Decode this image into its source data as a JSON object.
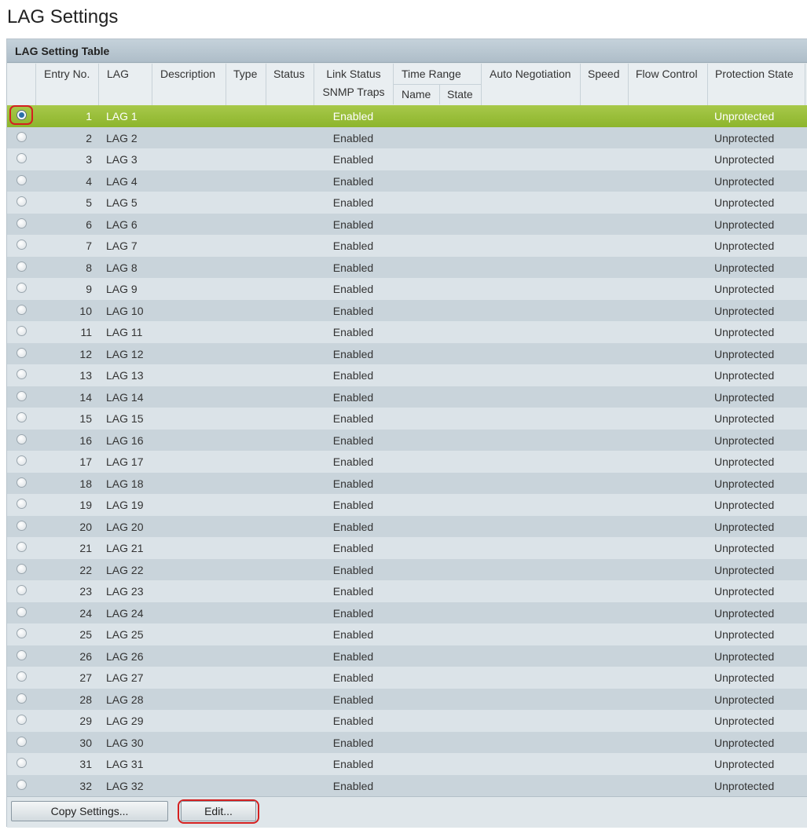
{
  "page": {
    "title": "LAG Settings"
  },
  "table": {
    "title": "LAG Setting Table",
    "headers": {
      "entry_no": "Entry No.",
      "lag": "LAG",
      "description": "Description",
      "type": "Type",
      "status": "Status",
      "link_status": "Link Status",
      "snmp_traps": "SNMP Traps",
      "time_range": "Time Range",
      "name": "Name",
      "state": "State",
      "auto_negotiation": "Auto Negotiation",
      "speed": "Speed",
      "flow_control": "Flow Control",
      "protection_state": "Protection State"
    },
    "selected_entry": 1,
    "rows": [
      {
        "entry": "1",
        "lag": "LAG 1",
        "link": "Enabled",
        "protection": "Unprotected"
      },
      {
        "entry": "2",
        "lag": "LAG 2",
        "link": "Enabled",
        "protection": "Unprotected"
      },
      {
        "entry": "3",
        "lag": "LAG 3",
        "link": "Enabled",
        "protection": "Unprotected"
      },
      {
        "entry": "4",
        "lag": "LAG 4",
        "link": "Enabled",
        "protection": "Unprotected"
      },
      {
        "entry": "5",
        "lag": "LAG 5",
        "link": "Enabled",
        "protection": "Unprotected"
      },
      {
        "entry": "6",
        "lag": "LAG 6",
        "link": "Enabled",
        "protection": "Unprotected"
      },
      {
        "entry": "7",
        "lag": "LAG 7",
        "link": "Enabled",
        "protection": "Unprotected"
      },
      {
        "entry": "8",
        "lag": "LAG 8",
        "link": "Enabled",
        "protection": "Unprotected"
      },
      {
        "entry": "9",
        "lag": "LAG 9",
        "link": "Enabled",
        "protection": "Unprotected"
      },
      {
        "entry": "10",
        "lag": "LAG 10",
        "link": "Enabled",
        "protection": "Unprotected"
      },
      {
        "entry": "11",
        "lag": "LAG 11",
        "link": "Enabled",
        "protection": "Unprotected"
      },
      {
        "entry": "12",
        "lag": "LAG 12",
        "link": "Enabled",
        "protection": "Unprotected"
      },
      {
        "entry": "13",
        "lag": "LAG 13",
        "link": "Enabled",
        "protection": "Unprotected"
      },
      {
        "entry": "14",
        "lag": "LAG 14",
        "link": "Enabled",
        "protection": "Unprotected"
      },
      {
        "entry": "15",
        "lag": "LAG 15",
        "link": "Enabled",
        "protection": "Unprotected"
      },
      {
        "entry": "16",
        "lag": "LAG 16",
        "link": "Enabled",
        "protection": "Unprotected"
      },
      {
        "entry": "17",
        "lag": "LAG 17",
        "link": "Enabled",
        "protection": "Unprotected"
      },
      {
        "entry": "18",
        "lag": "LAG 18",
        "link": "Enabled",
        "protection": "Unprotected"
      },
      {
        "entry": "19",
        "lag": "LAG 19",
        "link": "Enabled",
        "protection": "Unprotected"
      },
      {
        "entry": "20",
        "lag": "LAG 20",
        "link": "Enabled",
        "protection": "Unprotected"
      },
      {
        "entry": "21",
        "lag": "LAG 21",
        "link": "Enabled",
        "protection": "Unprotected"
      },
      {
        "entry": "22",
        "lag": "LAG 22",
        "link": "Enabled",
        "protection": "Unprotected"
      },
      {
        "entry": "23",
        "lag": "LAG 23",
        "link": "Enabled",
        "protection": "Unprotected"
      },
      {
        "entry": "24",
        "lag": "LAG 24",
        "link": "Enabled",
        "protection": "Unprotected"
      },
      {
        "entry": "25",
        "lag": "LAG 25",
        "link": "Enabled",
        "protection": "Unprotected"
      },
      {
        "entry": "26",
        "lag": "LAG 26",
        "link": "Enabled",
        "protection": "Unprotected"
      },
      {
        "entry": "27",
        "lag": "LAG 27",
        "link": "Enabled",
        "protection": "Unprotected"
      },
      {
        "entry": "28",
        "lag": "LAG 28",
        "link": "Enabled",
        "protection": "Unprotected"
      },
      {
        "entry": "29",
        "lag": "LAG 29",
        "link": "Enabled",
        "protection": "Unprotected"
      },
      {
        "entry": "30",
        "lag": "LAG 30",
        "link": "Enabled",
        "protection": "Unprotected"
      },
      {
        "entry": "31",
        "lag": "LAG 31",
        "link": "Enabled",
        "protection": "Unprotected"
      },
      {
        "entry": "32",
        "lag": "LAG 32",
        "link": "Enabled",
        "protection": "Unprotected"
      }
    ]
  },
  "footer": {
    "copy_settings_label": "Copy Settings...",
    "edit_label": "Edit..."
  },
  "colors": {
    "selected_row": "#98be38",
    "highlight_ring": "#d42020",
    "header_bar": "#b7c6d0"
  }
}
